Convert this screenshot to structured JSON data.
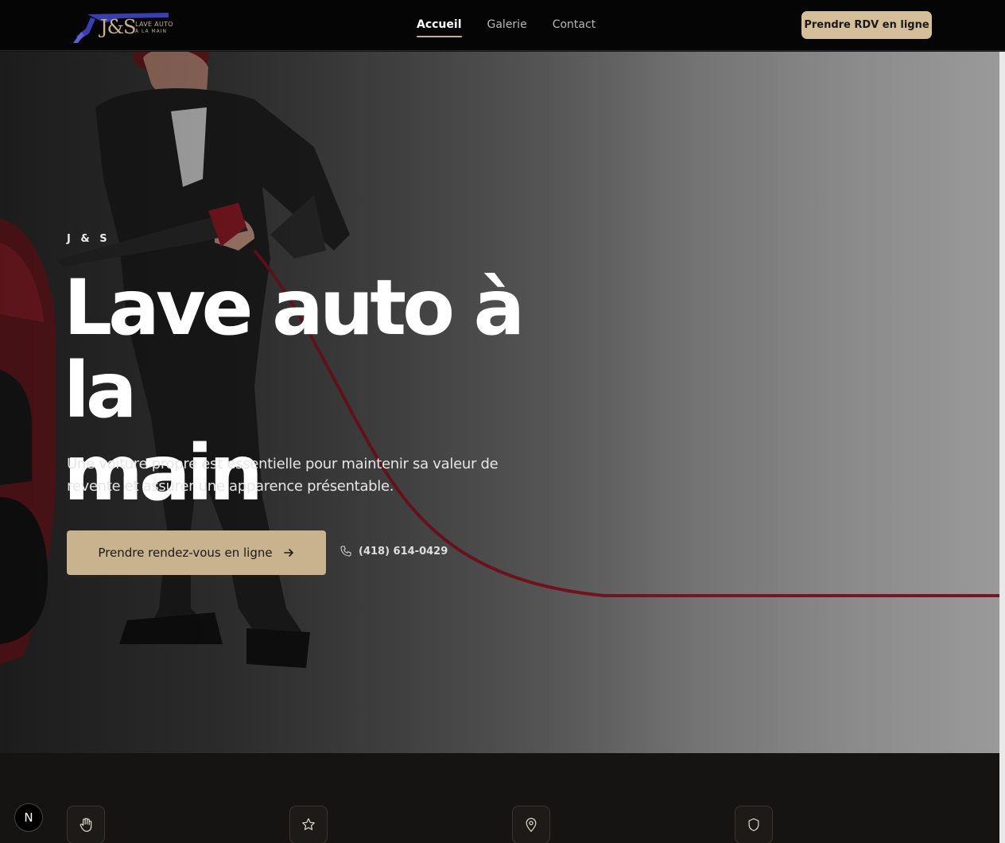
{
  "nav": {
    "logo": {
      "brand": "J&S",
      "line1": "LAVE AUTO",
      "line2": "À LA MAIN"
    },
    "links": [
      {
        "label": "Accueil",
        "active": true
      },
      {
        "label": "Galerie",
        "active": false
      },
      {
        "label": "Contact",
        "active": false
      }
    ],
    "cta_label": "Prendre RDV en ligne"
  },
  "hero": {
    "eyebrow": "J & S",
    "headline_line1": "Lave auto à la",
    "headline_line2": "main",
    "lede_line1": "Une voiture propre est essentielle pour maintenir sa valeur de",
    "lede_line2": "revente et assurer une apparence présentable.",
    "cta_label": "Prendre rendez-vous en ligne",
    "cta_icon": "arrow-right-icon",
    "phone": "(418) 614-0429",
    "phone_icon": "phone-icon"
  },
  "features": {
    "icons": [
      "hand-icon",
      "star-icon",
      "map-pin-icon",
      "shield-icon"
    ]
  },
  "dev_badge": {
    "label": "N"
  },
  "colors": {
    "accent": "#c9b28e",
    "nav_bg": "#050505",
    "strip_bg": "#151412",
    "hose": "#7a1420"
  }
}
